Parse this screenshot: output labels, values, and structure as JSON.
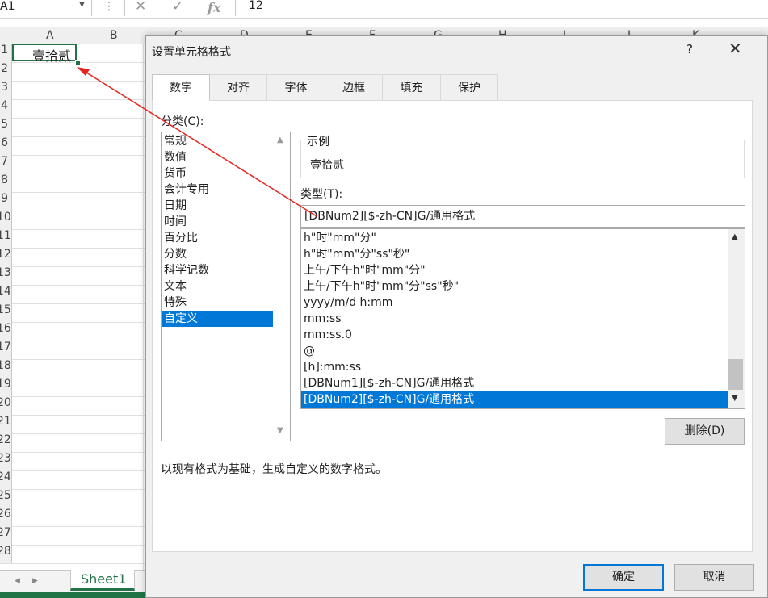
{
  "excel": {
    "name_box": "A1",
    "formula_value": "12",
    "column_headers": [
      "A",
      "B",
      "C",
      "D",
      "E",
      "F",
      "G",
      "H",
      "I",
      "J",
      "K"
    ],
    "row_numbers": [
      "1",
      "2",
      "3",
      "4",
      "5",
      "6",
      "7",
      "8",
      "9",
      "10",
      "11",
      "12",
      "13",
      "14",
      "15",
      "16",
      "17",
      "18",
      "19",
      "20",
      "21",
      "22",
      "23",
      "24",
      "25",
      "26",
      "27",
      "28"
    ],
    "cell_a1": "壹拾贰",
    "sheet_tab": "Sheet1"
  },
  "dialog": {
    "title": "设置单元格格式",
    "help": "?",
    "tabs": [
      "数字",
      "对齐",
      "字体",
      "边框",
      "填充",
      "保护"
    ],
    "active_tab": "数字",
    "category_label": "分类(C):",
    "categories": [
      "常规",
      "数值",
      "货币",
      "会计专用",
      "日期",
      "时间",
      "百分比",
      "分数",
      "科学记数",
      "文本",
      "特殊",
      "自定义"
    ],
    "selected_category": "自定义",
    "sample_label": "示例",
    "sample_value": "壹拾贰",
    "type_label": "类型(T):",
    "type_value": "[DBNum2][$-zh-CN]G/通用格式",
    "formats": [
      "h\"时\"mm\"分\"",
      "h\"时\"mm\"分\"ss\"秒\"",
      "上午/下午h\"时\"mm\"分\"",
      "上午/下午h\"时\"mm\"分\"ss\"秒\"",
      "yyyy/m/d h:mm",
      "mm:ss",
      "mm:ss.0",
      "@",
      "[h]:mm:ss",
      "[DBNum1][$-zh-CN]G/通用格式",
      "[DBNum2][$-zh-CN]G/通用格式"
    ],
    "selected_format": "[DBNum2][$-zh-CN]G/通用格式",
    "delete_button": "删除(D)",
    "description": "以现有格式为基础，生成自定义的数字格式。",
    "ok_button": "确定",
    "cancel_button": "取消"
  },
  "colors": {
    "excel_green": "#217346",
    "selection_blue": "#0078d7",
    "annotation_red": "#e8231d"
  }
}
